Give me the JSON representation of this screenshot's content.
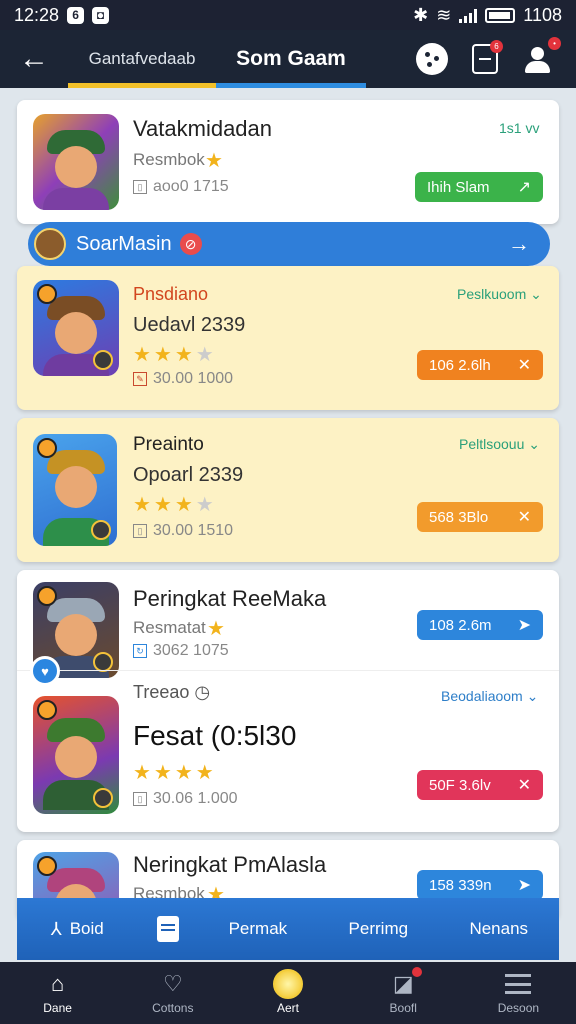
{
  "status": {
    "time": "12:28",
    "battery": "1108"
  },
  "appbar": {
    "back_icon": "←",
    "tabs": [
      "Gantafvedaab",
      "Som Gaam"
    ]
  },
  "card1": {
    "title": "Vatakmidadan",
    "subtitle": "Resmbok",
    "meta": "aoo0 1715",
    "link": "1s1 vv",
    "button": "Ihih Slam",
    "button_color": "#3bb34a"
  },
  "banner": {
    "label": "SoarMasin"
  },
  "card2": {
    "title": "Pnsdiano",
    "subtitle": "Uedavl 2339",
    "rating": 3,
    "meta": "30.00 1000",
    "link": "Peslkuoom",
    "button": "106 2.6lh",
    "button_color": "#f0821f"
  },
  "card3": {
    "title": "Preainto",
    "subtitle": "Opoarl 2339",
    "rating": 3,
    "meta": "30.00 1510",
    "link": "Peltlsoouu",
    "button": "568 3Blo",
    "button_color": "#f29b2c"
  },
  "card4": {
    "title": "Peringkat ReeMaka",
    "subtitle": "Resmatat",
    "meta": "3062 1075",
    "button": "108 2.6m",
    "button_color": "#2d86dc",
    "sub_label": "Treeao",
    "sub_link": "Beodaliaoom",
    "sub_title": "Fesat (0:5l30",
    "sub_rating": 4,
    "sub_meta": "30.06 1.000",
    "sub_button": "50F 3.6lv",
    "sub_button_color": "#e1355a"
  },
  "card5": {
    "title": "Neringkat PmAlasla",
    "subtitle": "Resmbok",
    "button": "158 339n",
    "button_color": "#2d86dc"
  },
  "filterbar": {
    "items": [
      "Boid",
      "",
      "Permak",
      "Perrimg",
      "Nenans"
    ]
  },
  "bottomnav": {
    "items": [
      "Dane",
      "Cottons",
      "Aert",
      "Boofl",
      "Desoon"
    ]
  }
}
